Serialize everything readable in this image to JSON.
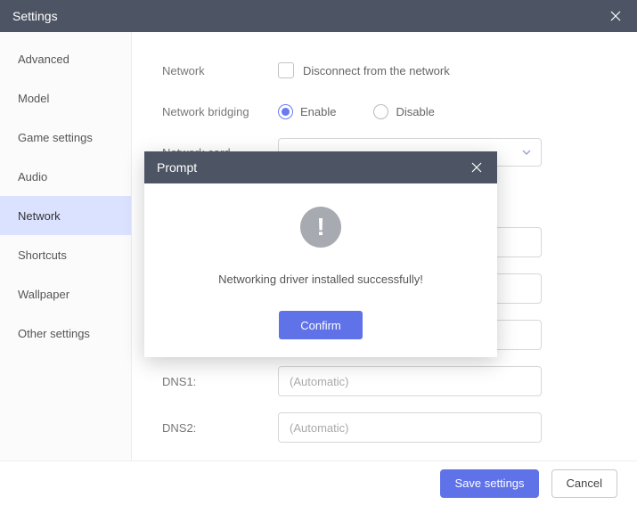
{
  "titlebar": {
    "title": "Settings"
  },
  "sidebar": {
    "items": [
      {
        "label": "Advanced"
      },
      {
        "label": "Model"
      },
      {
        "label": "Game settings"
      },
      {
        "label": "Audio"
      },
      {
        "label": "Network"
      },
      {
        "label": "Shortcuts"
      },
      {
        "label": "Wallpaper"
      },
      {
        "label": "Other settings"
      }
    ],
    "active_index": 4
  },
  "form": {
    "network_label": "Network",
    "disconnect_label": "Disconnect from the network",
    "bridging_label": "Network bridging",
    "enable_label": "Enable",
    "disable_label": "Disable",
    "card_label": "Network card",
    "dns1_label": "DNS1:",
    "dns2_label": "DNS2:",
    "placeholder_auto": "(Automatic)"
  },
  "footer": {
    "save_label": "Save settings",
    "cancel_label": "Cancel"
  },
  "modal": {
    "title": "Prompt",
    "message": "Networking driver installed successfully!",
    "confirm_label": "Confirm"
  }
}
